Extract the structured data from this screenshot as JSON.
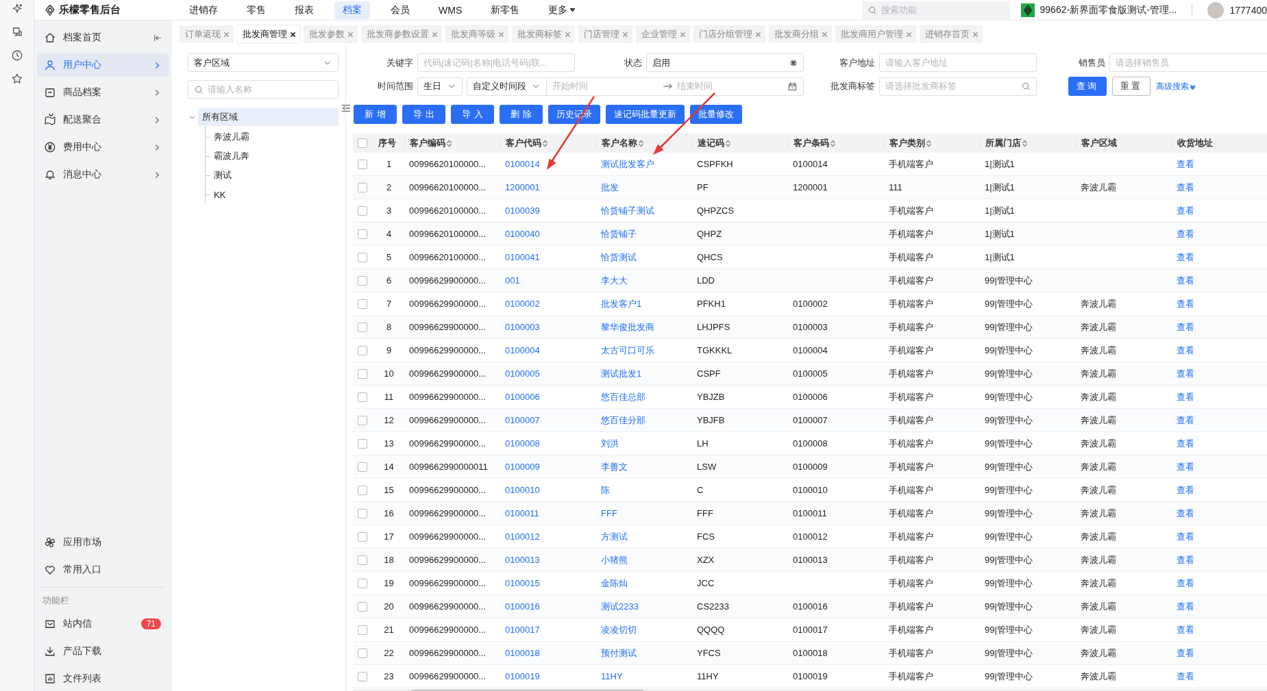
{
  "topbar": {
    "logo": "乐檬零售后台",
    "nav": [
      {
        "label": "进销存",
        "selected": false
      },
      {
        "label": "零售",
        "selected": false
      },
      {
        "label": "报表",
        "selected": false
      },
      {
        "label": "档案",
        "selected": true
      },
      {
        "label": "会员",
        "selected": false
      },
      {
        "label": "WMS",
        "selected": false
      },
      {
        "label": "新零售",
        "selected": false
      }
    ],
    "more": "更多",
    "search": {
      "placeholder": "搜索功能"
    },
    "store": "99662-新界面零食版测试-管理...",
    "user": "1777400"
  },
  "sidebar": {
    "home": "档案首页",
    "items": [
      {
        "label": "用户中心",
        "selected": true
      },
      {
        "label": "商品档案",
        "selected": false
      },
      {
        "label": "配送聚合",
        "selected": false
      },
      {
        "label": "费用中心",
        "selected": false
      },
      {
        "label": "消息中心",
        "selected": false
      }
    ],
    "apps": [
      "应用市场",
      "常用入口"
    ],
    "section": "功能栏",
    "tools": [
      {
        "label": "站内信",
        "badge": "71"
      },
      {
        "label": "产品下载"
      },
      {
        "label": "文件列表"
      }
    ]
  },
  "tabs": [
    {
      "label": "订单返现",
      "selected": false
    },
    {
      "label": "批发商管理",
      "selected": true
    },
    {
      "label": "批发参数",
      "selected": false
    },
    {
      "label": "批发商参数设置",
      "selected": false
    },
    {
      "label": "批发商等级",
      "selected": false
    },
    {
      "label": "批发商标签",
      "selected": false
    },
    {
      "label": "门店管理",
      "selected": false
    },
    {
      "label": "企业管理",
      "selected": false
    },
    {
      "label": "门店分组管理",
      "selected": false
    },
    {
      "label": "批发商分组",
      "selected": false
    },
    {
      "label": "批发商用户管理",
      "selected": false
    },
    {
      "label": "进销存首页",
      "selected": false
    }
  ],
  "tree": {
    "select": "客户区域",
    "search_placeholder": "请输入名称",
    "root": {
      "label": "所有区域",
      "expanded": true,
      "selected": true,
      "children": [
        {
          "label": "奔波儿霸"
        },
        {
          "label": "霸波儿奔"
        },
        {
          "label": "测试"
        },
        {
          "label": "KK"
        }
      ]
    }
  },
  "filters": {
    "keyword": {
      "label": "关键字",
      "placeholder": "代码|速记码|名称|电话号码|联..."
    },
    "status": {
      "label": "状态",
      "value": "启用"
    },
    "address": {
      "label": "客户地址",
      "placeholder": "请输入客户地址"
    },
    "salesman": {
      "label": "销售员",
      "placeholder": "请选择销售员"
    },
    "time": {
      "label": "时间范围",
      "type": "生日",
      "mode": "自定义时间段",
      "start_placeholder": "开始时间",
      "end_placeholder": "结束时间"
    },
    "tag": {
      "label": "批发商标签",
      "placeholder": "请选择批发商标签"
    },
    "query": "查询",
    "reset": "重置",
    "advanced": "高级搜索"
  },
  "actions": [
    "新增",
    "导出",
    "导入",
    "删除",
    "历史记录",
    "速记码批量更新",
    "批量修改"
  ],
  "table": {
    "all_checked": false,
    "columns": [
      {
        "label": "序号",
        "sortable": false,
        "kind": "text"
      },
      {
        "label": "客户编码",
        "sortable": true,
        "kind": "text"
      },
      {
        "label": "客户代码",
        "sortable": true,
        "kind": "link"
      },
      {
        "label": "客户名称",
        "sortable": true,
        "kind": "link"
      },
      {
        "label": "速记码",
        "sortable": true,
        "kind": "text"
      },
      {
        "label": "客户条码",
        "sortable": true,
        "kind": "text"
      },
      {
        "label": "客户类别",
        "sortable": true,
        "kind": "text"
      },
      {
        "label": "所属门店",
        "sortable": true,
        "kind": "text"
      },
      {
        "label": "客户区域",
        "sortable": false,
        "kind": "text"
      },
      {
        "label": "收货地址",
        "sortable": false,
        "kind": "link"
      }
    ],
    "rows": [
      {
        "checked": false,
        "cells": [
          "1",
          "00996620100000...",
          "0100014",
          "测试批发客户",
          "CSPFKH",
          "0100014",
          "手机端客户",
          "1|测试1",
          "",
          "查看"
        ]
      },
      {
        "checked": false,
        "cells": [
          "2",
          "00996620100000...",
          "1200001",
          "批发",
          "PF",
          "1200001",
          "111",
          "1|测试1",
          "奔波儿霸",
          "查看"
        ]
      },
      {
        "checked": false,
        "cells": [
          "3",
          "00996620100000...",
          "0100039",
          "恰货铺子测试",
          "QHPZCS",
          "",
          "手机端客户",
          "1|测试1",
          "",
          "查看"
        ]
      },
      {
        "checked": false,
        "cells": [
          "4",
          "00996620100000...",
          "0100040",
          "恰货铺子",
          "QHPZ",
          "",
          "手机端客户",
          "1|测试1",
          "",
          "查看"
        ]
      },
      {
        "checked": false,
        "cells": [
          "5",
          "00996620100000...",
          "0100041",
          "恰货测试",
          "QHCS",
          "",
          "手机端客户",
          "1|测试1",
          "",
          "查看"
        ]
      },
      {
        "checked": false,
        "cells": [
          "6",
          "00996629900000...",
          "001",
          "李大大",
          "LDD",
          "",
          "手机端客户",
          "99|管理中心",
          "",
          "查看"
        ]
      },
      {
        "checked": false,
        "cells": [
          "7",
          "00996629900000...",
          "0100002",
          "批发客户1",
          "PFKH1",
          "0100002",
          "手机端客户",
          "99|管理中心",
          "奔波儿霸",
          "查看"
        ]
      },
      {
        "checked": false,
        "cells": [
          "8",
          "00996629900000...",
          "0100003",
          "黎华俊批发商",
          "LHJPFS",
          "0100003",
          "手机端客户",
          "99|管理中心",
          "奔波儿霸",
          "查看"
        ]
      },
      {
        "checked": false,
        "cells": [
          "9",
          "00996629900000...",
          "0100004",
          "太古可口可乐",
          "TGKKKL",
          "0100004",
          "手机端客户",
          "99|管理中心",
          "奔波儿霸",
          "查看"
        ]
      },
      {
        "checked": false,
        "cells": [
          "10",
          "00996629900000...",
          "0100005",
          "测试批发1",
          "CSPF",
          "0100005",
          "手机端客户",
          "99|管理中心",
          "奔波儿霸",
          "查看"
        ]
      },
      {
        "checked": false,
        "cells": [
          "11",
          "00996629900000...",
          "0100006",
          "悠百佳总部",
          "YBJZB",
          "0100006",
          "手机端客户",
          "99|管理中心",
          "奔波儿霸",
          "查看"
        ]
      },
      {
        "checked": false,
        "cells": [
          "12",
          "00996629900000...",
          "0100007",
          "悠百佳分部",
          "YBJFB",
          "0100007",
          "手机端客户",
          "99|管理中心",
          "奔波儿霸",
          "查看"
        ]
      },
      {
        "checked": false,
        "cells": [
          "13",
          "00996629900000...",
          "0100008",
          "刘洪",
          "LH",
          "0100008",
          "手机端客户",
          "99|管理中心",
          "奔波儿霸",
          "查看"
        ]
      },
      {
        "checked": false,
        "cells": [
          "14",
          "0099662990000011",
          "0100009",
          "李善文",
          "LSW",
          "0100009",
          "手机端客户",
          "99|管理中心",
          "奔波儿霸",
          "查看"
        ]
      },
      {
        "checked": false,
        "cells": [
          "15",
          "00996629900000...",
          "0100010",
          "陈",
          "C",
          "0100010",
          "手机端客户",
          "99|管理中心",
          "奔波儿霸",
          "查看"
        ]
      },
      {
        "checked": false,
        "cells": [
          "16",
          "00996629900000...",
          "0100011",
          "FFF",
          "FFF",
          "0100011",
          "手机端客户",
          "99|管理中心",
          "奔波儿霸",
          "查看"
        ]
      },
      {
        "checked": false,
        "cells": [
          "17",
          "00996629900000...",
          "0100012",
          "方测试",
          "FCS",
          "0100012",
          "手机端客户",
          "99|管理中心",
          "奔波儿霸",
          "查看"
        ]
      },
      {
        "checked": false,
        "cells": [
          "18",
          "00996629900000...",
          "0100013",
          "小猪熊",
          "XZX",
          "0100013",
          "手机端客户",
          "99|管理中心",
          "奔波儿霸",
          "查看"
        ]
      },
      {
        "checked": false,
        "cells": [
          "19",
          "00996629900000...",
          "0100015",
          "金陈灿",
          "JCC",
          "",
          "手机端客户",
          "99|管理中心",
          "奔波儿霸",
          "查看"
        ]
      },
      {
        "checked": false,
        "cells": [
          "20",
          "00996629900000...",
          "0100016",
          "测试2233",
          "CS2233",
          "0100016",
          "手机端客户",
          "99|管理中心",
          "奔波儿霸",
          "查看"
        ]
      },
      {
        "checked": false,
        "cells": [
          "21",
          "00996629900000...",
          "0100017",
          "凌凌切切",
          "QQQQ",
          "0100017",
          "手机端客户",
          "99|管理中心",
          "奔波儿霸",
          "查看"
        ]
      },
      {
        "checked": false,
        "cells": [
          "22",
          "00996629900000...",
          "0100018",
          "预付测试",
          "YFCS",
          "0100018",
          "手机端客户",
          "99|管理中心",
          "奔波儿霸",
          "查看"
        ]
      },
      {
        "checked": false,
        "cells": [
          "23",
          "00996629900000...",
          "0100019",
          "11HY",
          "11HY",
          "0100019",
          "手机端客户",
          "99|管理中心",
          "奔波儿霸",
          "查看"
        ]
      }
    ]
  }
}
